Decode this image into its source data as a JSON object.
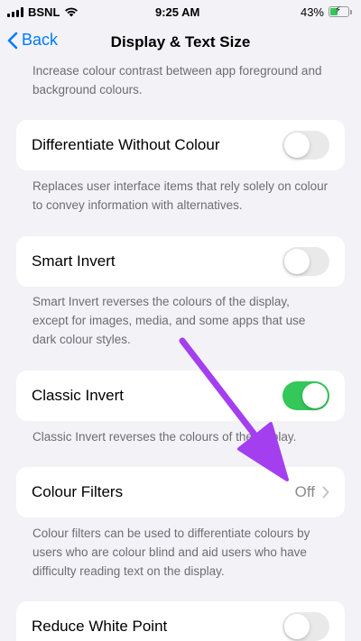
{
  "status_bar": {
    "carrier": "BSNL",
    "time": "9:25 AM",
    "battery_percent": "43%",
    "battery_level": 0.43
  },
  "nav": {
    "back_label": "Back",
    "title": "Display & Text Size"
  },
  "rows": [
    {
      "footnote_above": "Increase colour contrast between app foreground and background colours."
    },
    {
      "label": "Differentiate Without Colour",
      "toggle_on": false,
      "footnote": "Replaces user interface items that rely solely on colour to convey information with alternatives."
    },
    {
      "label": "Smart Invert",
      "toggle_on": false,
      "footnote": "Smart Invert reverses the colours of the display, except for images, media, and some apps that use dark colour styles."
    },
    {
      "label": "Classic Invert",
      "toggle_on": true,
      "footnote": "Classic Invert reverses the colours of the display."
    },
    {
      "label": "Colour Filters",
      "value": "Off",
      "footnote": "Colour filters can be used to differentiate colours by users who are colour blind and aid users who have difficulty reading text on the display."
    },
    {
      "label": "Reduce White Point",
      "toggle_on": false
    }
  ],
  "colors": {
    "accent": "#007aff",
    "toggle_on": "#34c759",
    "toggle_off": "#e9e9ea",
    "annotation_arrow": "#a43ff0"
  },
  "icons": {
    "back": "chevron-left-icon",
    "disclosure": "chevron-right-icon",
    "wifi": "wifi-icon",
    "battery": "battery-charging-icon"
  }
}
